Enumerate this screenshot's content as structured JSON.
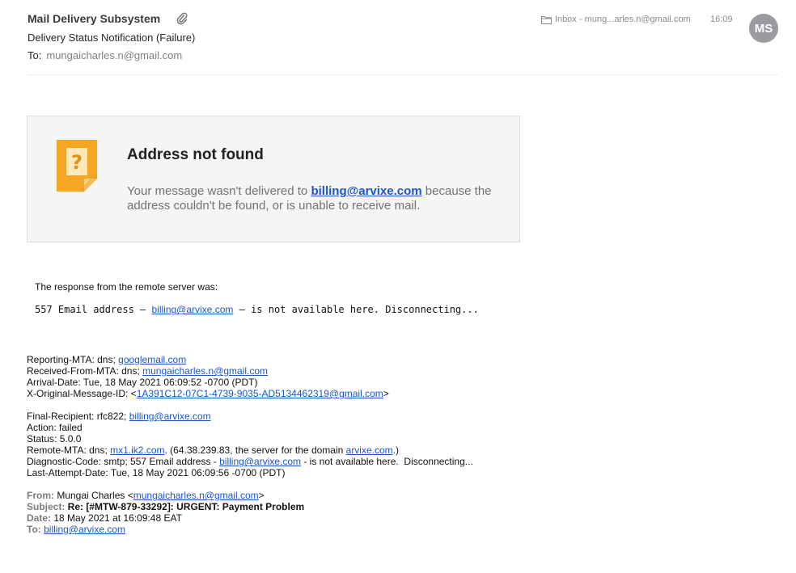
{
  "header": {
    "sender": "Mail Delivery Subsystem",
    "subject": "Delivery Status Notification (Failure)",
    "to_label": "To:",
    "to_address": "mungaicharles.n@gmail.com",
    "mailbox": "Inbox - mung...arles.n@gmail.com",
    "time": "16:09",
    "avatar_initials": "MS",
    "icons": {
      "attachment": "paperclip-icon",
      "mailbox": "folder-icon"
    }
  },
  "notice": {
    "title": "Address not found",
    "body_before": "Your message wasn't delivered to ",
    "email": "billing@arvixe.com",
    "body_after": " because the address couldn't be found, or is unable to receive mail.",
    "icon": "question-note-icon",
    "icon_color": "#F5A623"
  },
  "response": {
    "label": "The response from the remote server was:",
    "prefix": "557 Email address – ",
    "email": "billing@arvixe.com",
    "suffix": " – is not available here. Disconnecting..."
  },
  "details": {
    "reporting_mta_label": "Reporting-MTA: dns; ",
    "reporting_mta_link": "googlemail.com",
    "received_from_label": "Received-From-MTA: dns; ",
    "received_from_link": "mungaicharles.n@gmail.com",
    "arrival_date": "Arrival-Date: Tue, 18 May 2021 06:09:52 -0700 (PDT)",
    "original_id_label": "X-Original-Message-ID: <",
    "original_id_link": "1A391C12-07C1-4739-9035-AD5134462319@gmail.com",
    "original_id_close": ">",
    "final_recipient_label": "Final-Recipient: rfc822; ",
    "final_recipient_link": "billing@arvixe.com",
    "action": "Action: failed",
    "status": "Status: 5.0.0",
    "remote_mta_label": "Remote-MTA: dns; ",
    "remote_mta_link": "mx1.ik2.com",
    "remote_mta_mid": ". (64.38.239.83, the server for the domain ",
    "remote_mta_domain": "arvixe.com",
    "remote_mta_end": ".)",
    "diagnostic_label": "Diagnostic-Code: smtp; 557 Email address - ",
    "diagnostic_link": "billing@arvixe.com",
    "diagnostic_end": " - is not available here.  Disconnecting...",
    "last_attempt": "Last-Attempt-Date: Tue, 18 May 2021 06:09:56 -0700 (PDT)"
  },
  "forwarded": {
    "from_label": "From:",
    "from_name": " Mungai Charles <",
    "from_link": "mungaicharles.n@gmail.com",
    "from_close": ">",
    "subject_label": "Subject:",
    "subject_value": " Re: [#MTW-879-33292]: URGENT: Payment Problem",
    "date_label": "Date:",
    "date_value": " 18 May 2021 at 16:09:48 EAT",
    "to_label": "To:",
    "to_link": "billing@arvixe.com"
  }
}
